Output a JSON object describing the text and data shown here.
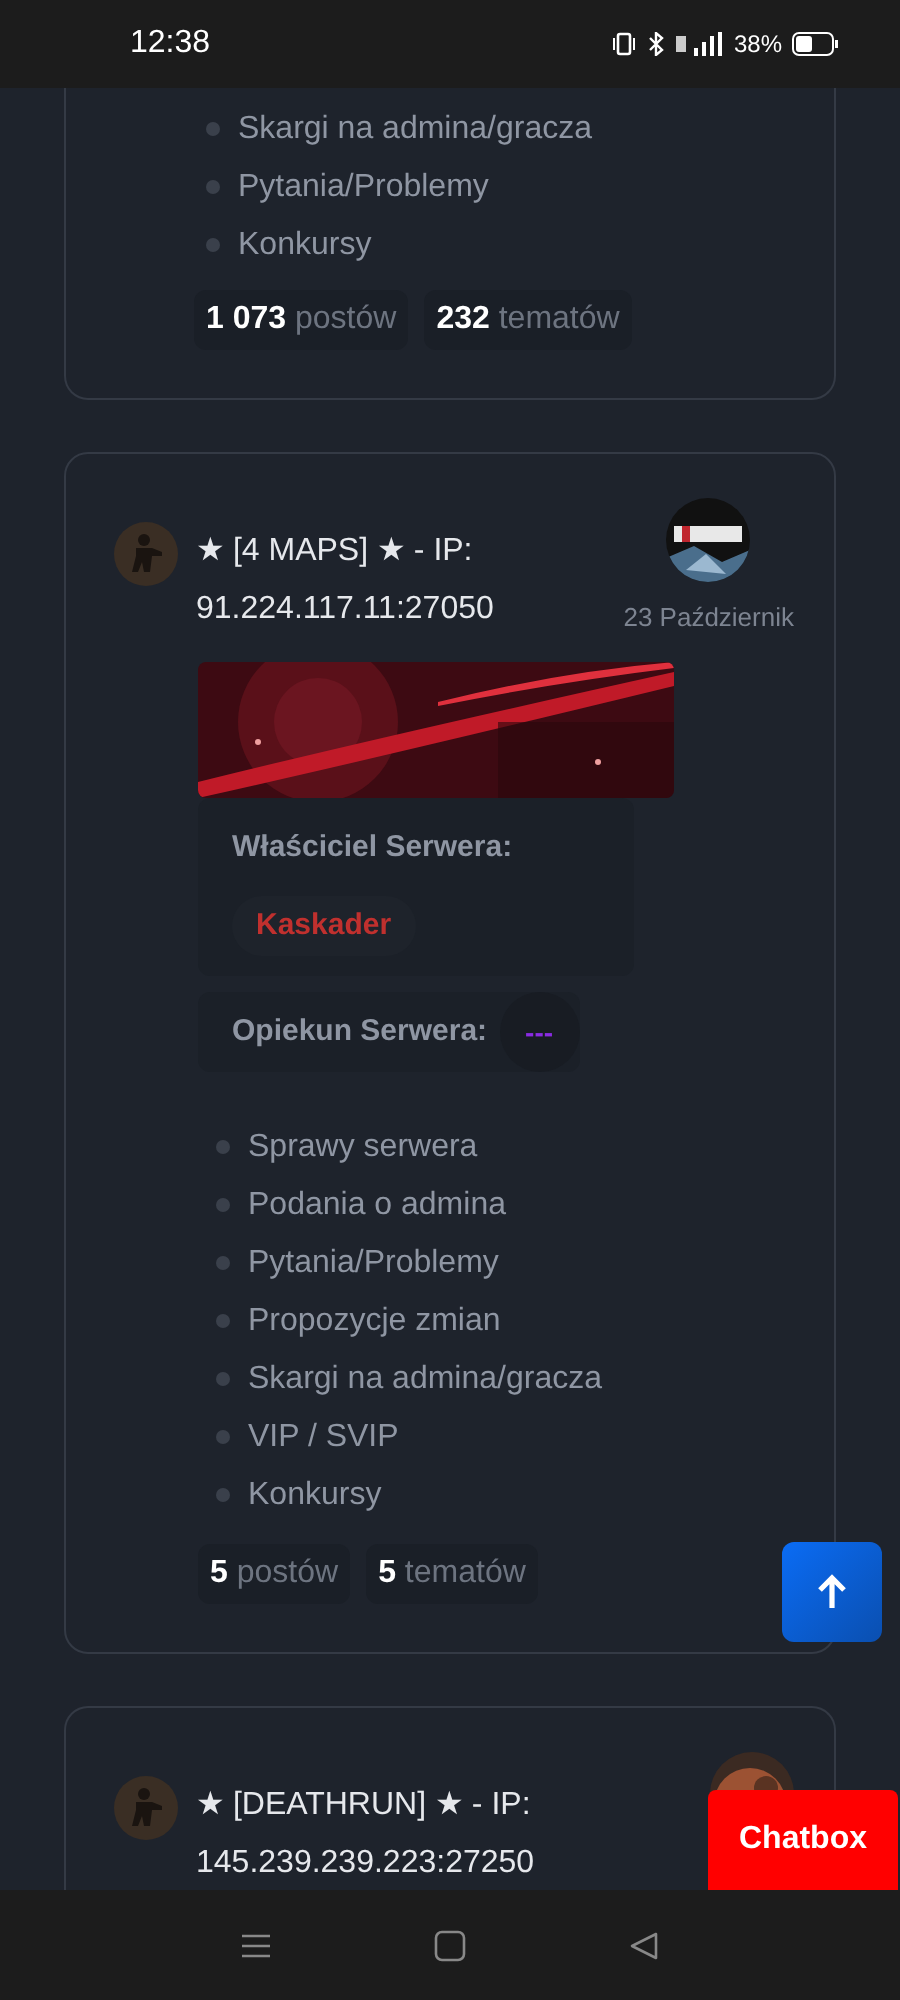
{
  "status_bar": {
    "time": "12:38",
    "battery": "38%"
  },
  "forums": [
    {
      "kind": "partial",
      "categories": [
        "Skargi na admina/gracza",
        "Pytania/Problemy",
        "Konkursy"
      ],
      "stats": [
        {
          "count": "1 073",
          "label": "postów"
        },
        {
          "count": "232",
          "label": "tematów"
        }
      ]
    },
    {
      "kind": "full",
      "title": "★ [4 MAPS] ★ - IP: 91.224.117.11:27050",
      "date": "23 Październik",
      "owner_label": "Właściciel Serwera:",
      "owner": "Kaskader",
      "caretaker_label": "Opiekun Serwera:",
      "caretaker": "---",
      "categories": [
        "Sprawy serwera",
        "Podania o admina",
        "Pytania/Problemy",
        "Propozycje zmian",
        "Skargi na admina/gracza",
        "VIP / SVIP",
        "Konkursy"
      ],
      "stats": [
        {
          "count": "5",
          "label": "postów"
        },
        {
          "count": "5",
          "label": "tematów"
        }
      ]
    },
    {
      "kind": "header",
      "title": "★ [DEATHRUN] ★ - IP: 145.239.239.223:27250"
    }
  ],
  "chatbox": "Chatbox"
}
